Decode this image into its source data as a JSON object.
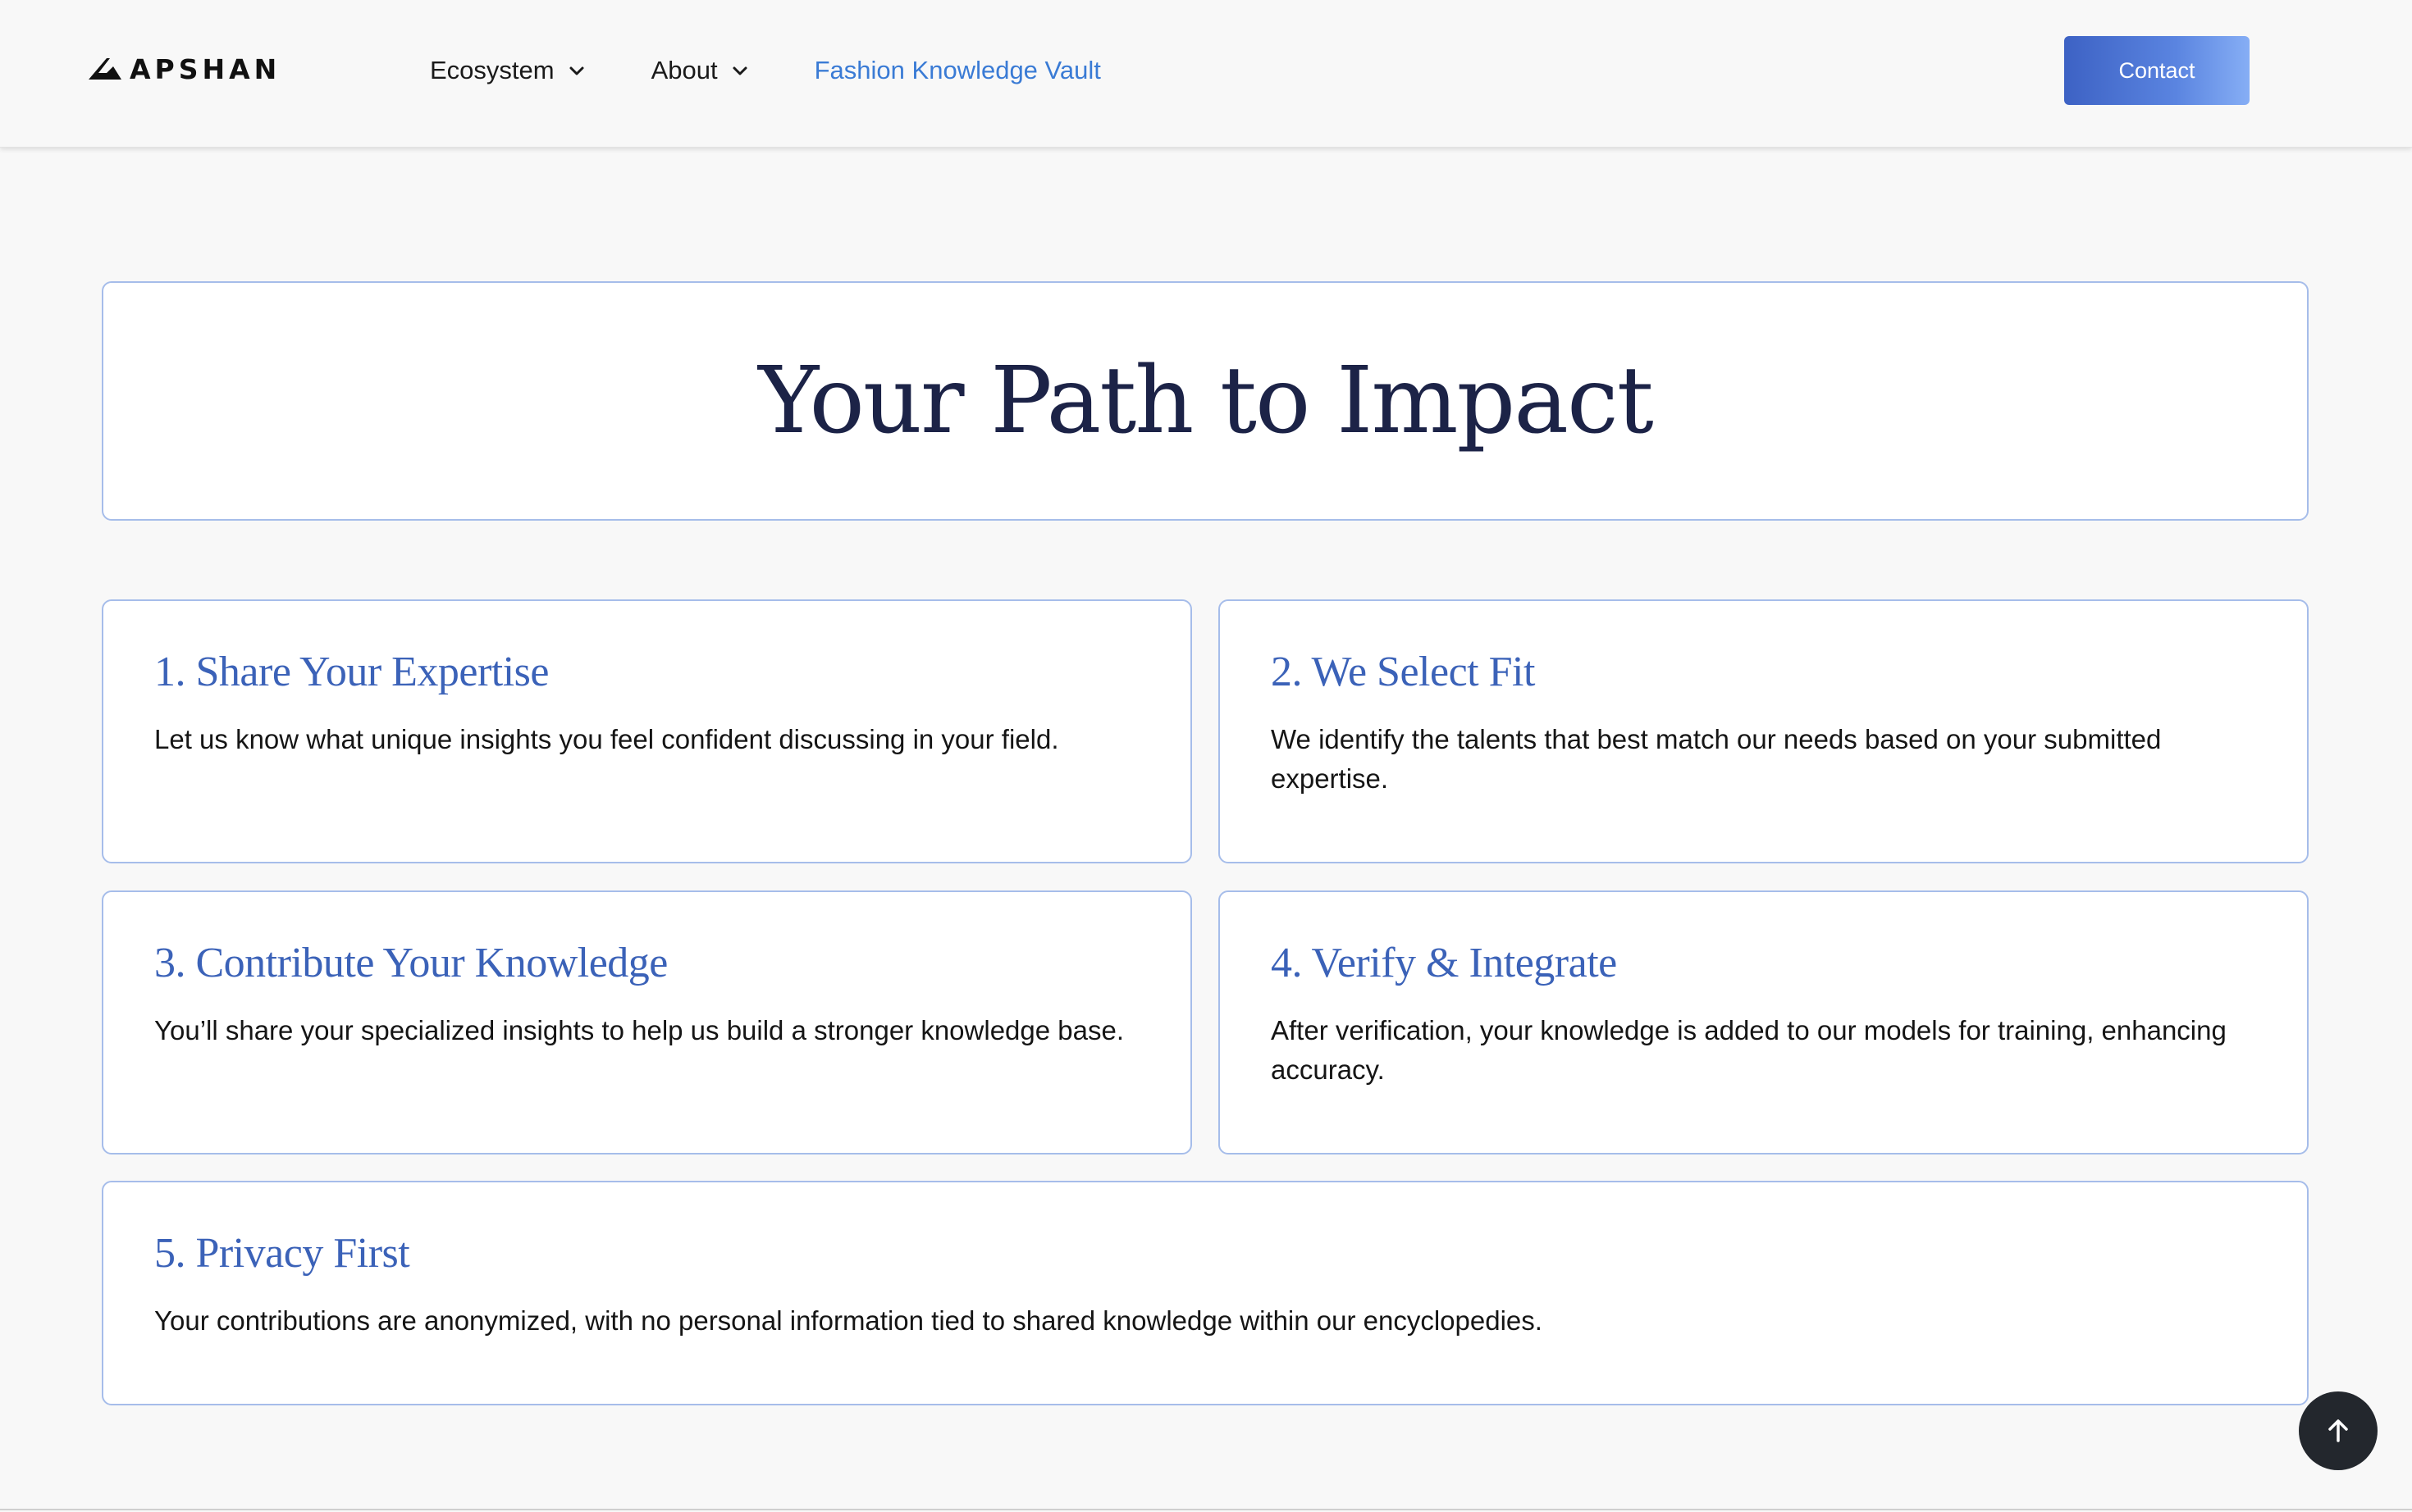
{
  "header": {
    "logo_text": "APSHAN",
    "nav": [
      {
        "label": "Ecosystem",
        "has_dropdown": true
      },
      {
        "label": "About",
        "has_dropdown": true
      },
      {
        "label": "Fashion Knowledge Vault",
        "has_dropdown": false,
        "active": true
      }
    ],
    "contact_label": "Contact"
  },
  "hero": {
    "title": "Your Path to Impact"
  },
  "steps": [
    {
      "title": "1. Share Your Expertise",
      "text": "Let us know what unique insights you feel confident discussing in your field."
    },
    {
      "title": "2. We Select Fit",
      "text": "We identify the talents that best match our needs based on your submitted expertise."
    },
    {
      "title": "3. Contribute Your Knowledge",
      "text": "You’ll share your specialized insights to help us build a stronger knowledge base."
    },
    {
      "title": "4. Verify & Integrate",
      "text": "After verification, your knowledge is added to our models for training, enhancing accuracy."
    },
    {
      "title": "5. Privacy First",
      "text": "Your contributions are anonymized, with no personal information tied to shared knowledge within our encyclopedies."
    }
  ],
  "colors": {
    "accent": "#3a7bd5",
    "heading_dark": "#1c2347",
    "card_border": "#a6bdea",
    "button_gradient_start": "#3d62c4",
    "button_gradient_end": "#86aef5"
  },
  "icons": {
    "dropdown": "chevron-down-icon",
    "back_to_top": "arrow-up-icon"
  }
}
